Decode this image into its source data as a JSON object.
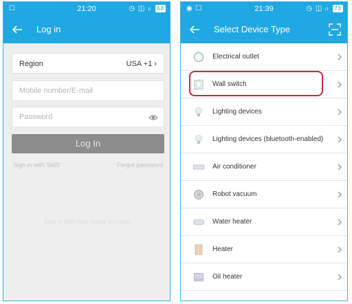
{
  "login_screen": {
    "status_bar": {
      "left_icons": "☐",
      "time": "21:20",
      "right_icons": "◷ ◫ ᵢₗ",
      "battery": "68"
    },
    "title": "Log in",
    "region": {
      "label": "Region",
      "value": "USA +1"
    },
    "phone_email": {
      "placeholder": "Mobile number/E-mail"
    },
    "password": {
      "placeholder": "Password"
    },
    "login_button": "Log In",
    "sms_link": "Sign in with SMS",
    "forgot_link": "Forgot password",
    "social_text": "Sign in with your social account"
  },
  "device_screen": {
    "status_bar": {
      "left_icons": "◉ ☐",
      "time": "21:39",
      "right_icons": "◷ ◫ ᵢₗ",
      "battery": "73"
    },
    "title": "Select Device Type",
    "devices": [
      {
        "label": "Electrical outlet",
        "icon": "outlet-icon"
      },
      {
        "label": "Wall switch",
        "icon": "wall-switch-icon"
      },
      {
        "label": "Lighting devices",
        "icon": "bulb-icon"
      },
      {
        "label": "Lighting devices (bluetooth-enabled)",
        "icon": "bulb-icon"
      },
      {
        "label": "Air conditioner",
        "icon": "air-conditioner-icon"
      },
      {
        "label": "Robot vacuum",
        "icon": "robot-vacuum-icon"
      },
      {
        "label": "Water heater",
        "icon": "water-heater-icon"
      },
      {
        "label": "Heater",
        "icon": "heater-icon"
      },
      {
        "label": "Oil heater",
        "icon": "oil-heater-icon"
      }
    ],
    "highlighted_item": "Wall switch"
  },
  "colors": {
    "accent": "#20a8e3",
    "highlight": "#c9283a",
    "disabled_button": "#8c8c8c"
  }
}
